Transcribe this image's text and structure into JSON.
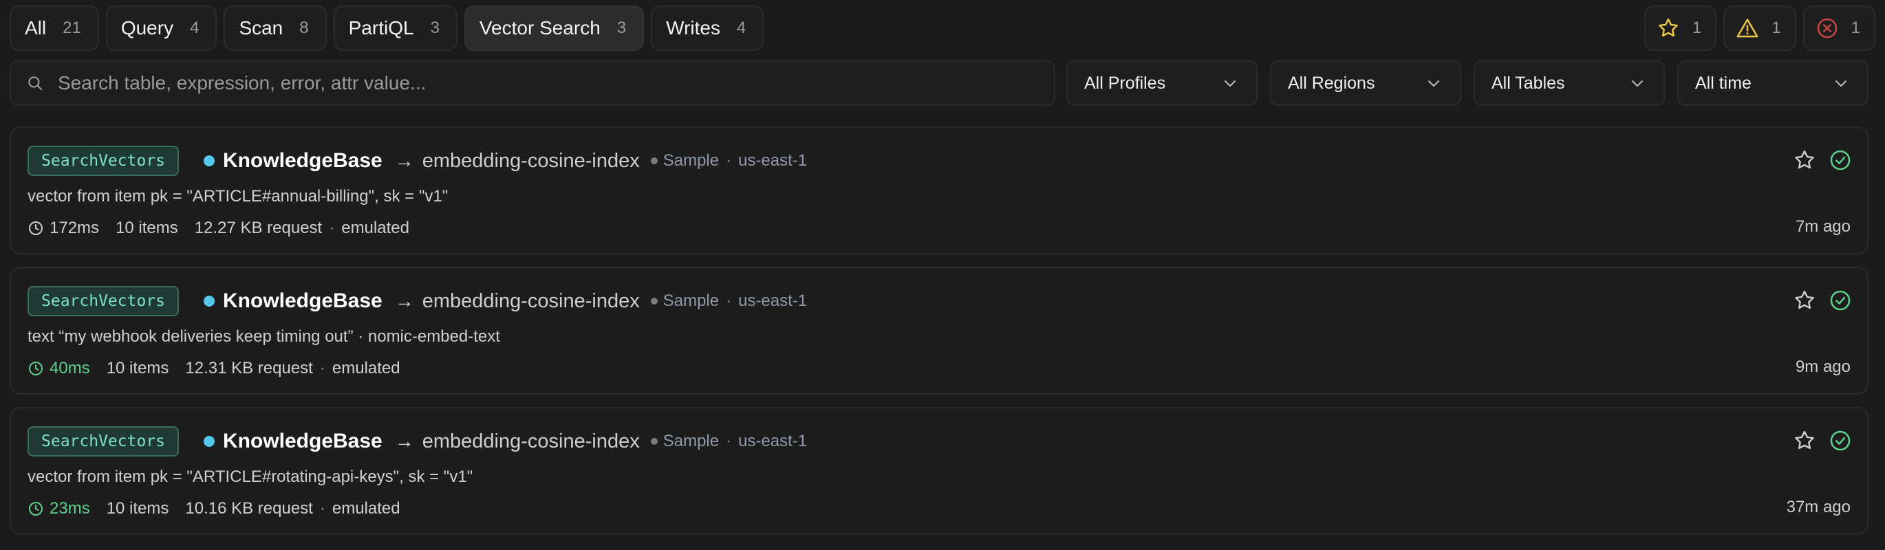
{
  "tabs": [
    {
      "label": "All",
      "count": "21",
      "active": false
    },
    {
      "label": "Query",
      "count": "4",
      "active": false
    },
    {
      "label": "Scan",
      "count": "8",
      "active": false
    },
    {
      "label": "PartiQL",
      "count": "3",
      "active": false
    },
    {
      "label": "Vector Search",
      "count": "3",
      "active": true
    },
    {
      "label": "Writes",
      "count": "4",
      "active": false
    }
  ],
  "status_filters": {
    "starred": {
      "icon": "star-icon",
      "count": "1",
      "color": "#e8c547"
    },
    "warnings": {
      "icon": "warning-icon",
      "count": "1",
      "color": "#e8c547"
    },
    "errors": {
      "icon": "error-icon",
      "count": "1",
      "color": "#c84646"
    }
  },
  "search": {
    "placeholder": "Search table, expression, error, attr value..."
  },
  "filters": {
    "profiles": "All Profiles",
    "regions": "All Regions",
    "tables": "All Tables",
    "time": "All time"
  },
  "colors": {
    "accent_green": "#5fd08c",
    "badge_text": "#7fe3c3",
    "live_dot": "#54c8ea"
  },
  "entries": [
    {
      "operation": "SearchVectors",
      "table": "KnowledgeBase",
      "arrow": "→",
      "index": "embedding-cosine-index",
      "profile": "Sample",
      "region": "us-east-1",
      "expression": "vector from item pk = \"ARTICLE#annual-billing\", sk = \"v1\"",
      "duration": "172ms",
      "items": "10 items",
      "request_size": "12.27 KB request",
      "mode": "emulated",
      "ago": "7m ago"
    },
    {
      "operation": "SearchVectors",
      "table": "KnowledgeBase",
      "arrow": "→",
      "index": "embedding-cosine-index",
      "profile": "Sample",
      "region": "us-east-1",
      "expression": "text “my webhook deliveries keep timing out” · nomic-embed-text",
      "duration": "40ms",
      "items": "10 items",
      "request_size": "12.31 KB request",
      "mode": "emulated",
      "ago": "9m ago"
    },
    {
      "operation": "SearchVectors",
      "table": "KnowledgeBase",
      "arrow": "→",
      "index": "embedding-cosine-index",
      "profile": "Sample",
      "region": "us-east-1",
      "expression": "vector from item pk = \"ARTICLE#rotating-api-keys\", sk = \"v1\"",
      "duration": "23ms",
      "items": "10 items",
      "request_size": "10.16 KB request",
      "mode": "emulated",
      "ago": "37m ago"
    }
  ]
}
